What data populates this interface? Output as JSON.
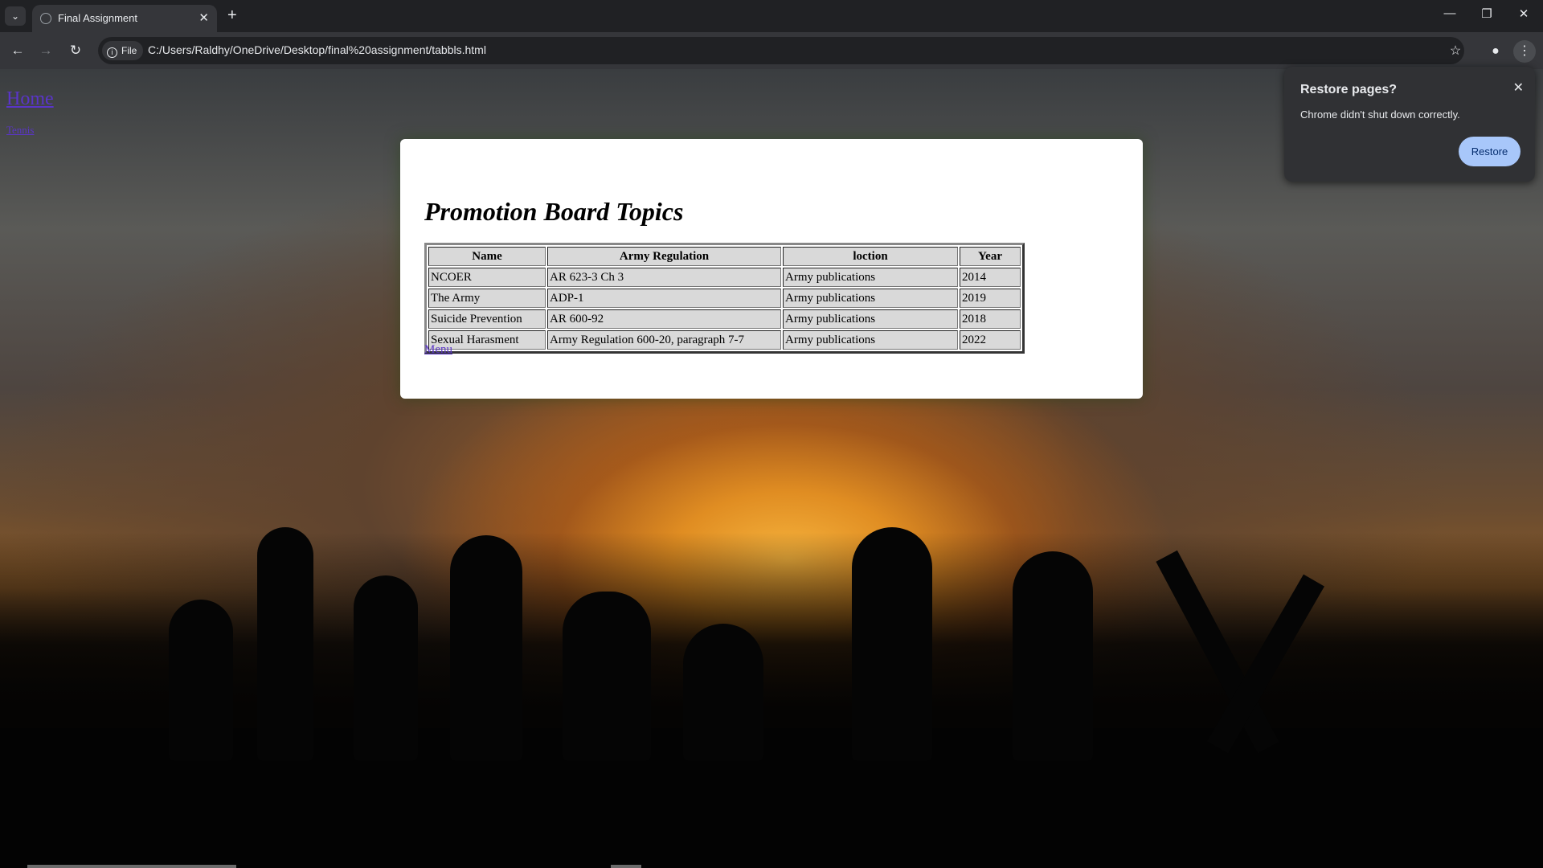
{
  "browser": {
    "tab_title": "Final Assignment",
    "chip_label": "File",
    "url": "C:/Users/Raldhy/OneDrive/Desktop/final%20assignment/tabbls.html"
  },
  "page": {
    "home_link": "Home",
    "small_link": "Tennis",
    "title": "Promotion Board Topics",
    "table": {
      "headers": [
        "Name",
        "Army Regulation",
        "loction",
        "Year"
      ],
      "rows": [
        [
          "NCOER",
          "AR 623-3 Ch 3",
          "Army publications",
          "2014"
        ],
        [
          "The Army",
          "ADP-1",
          "Army publications",
          "2019"
        ],
        [
          "Suicide Prevention",
          "AR 600-92",
          "Army publications",
          "2018"
        ],
        [
          "Sexual Harasment",
          "Army Regulation 600-20, paragraph 7-7",
          "Army publications",
          "2022"
        ]
      ]
    },
    "menu_link": "Menu"
  },
  "popup": {
    "title": "Restore pages?",
    "message": "Chrome didn't shut down correctly.",
    "button": "Restore"
  }
}
